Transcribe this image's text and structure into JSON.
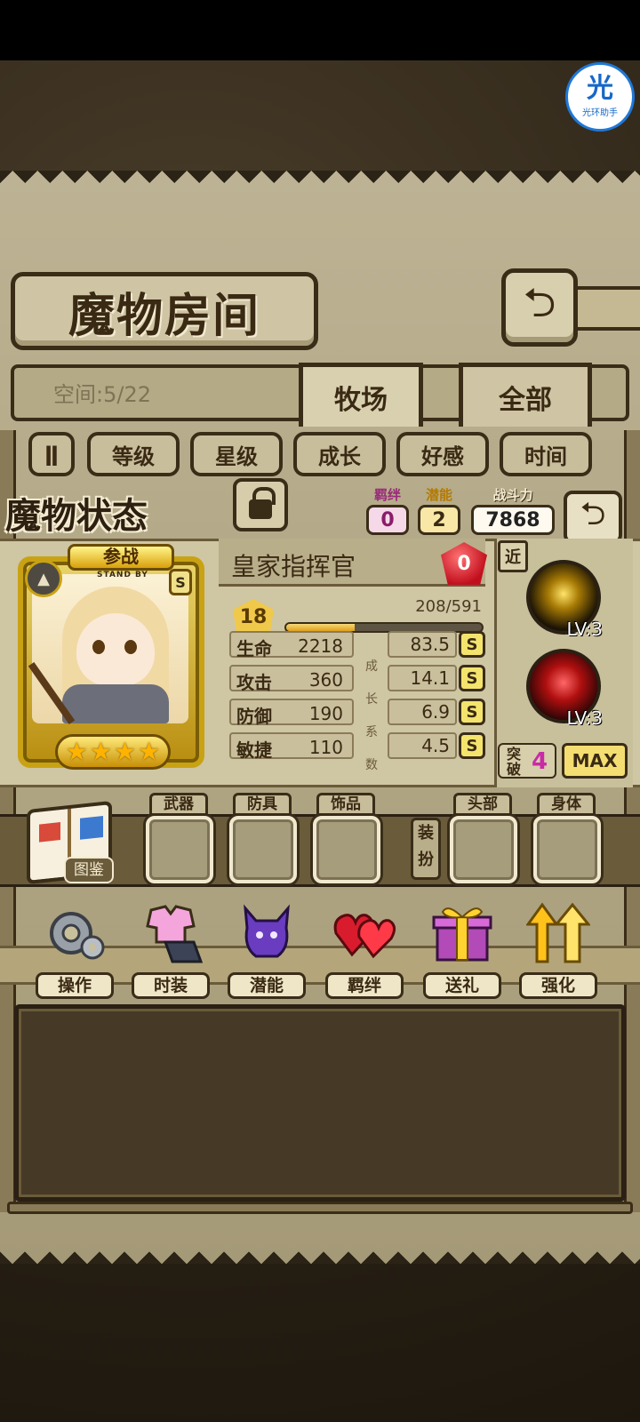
{
  "assistant_badge": {
    "glyph": "光",
    "label": "光环助手"
  },
  "page_title": "魔物房间",
  "space": "空间:5/22",
  "tabs": [
    {
      "label": "牧场",
      "active": true
    },
    {
      "label": "全部",
      "active": false
    }
  ],
  "filters": {
    "pause_icon": "pause-icon",
    "items": [
      "等级",
      "星级",
      "成长",
      "好感",
      "时间"
    ]
  },
  "status": {
    "title": "魔物状态",
    "bond": {
      "label": "羁绊",
      "value": "0"
    },
    "potential": {
      "label": "潜能",
      "value": "2"
    },
    "power": {
      "label": "战斗力",
      "value": "7868"
    }
  },
  "monster": {
    "deploy_label": "参战",
    "standby": "STAND BY",
    "rank": "S",
    "stars": 4,
    "name": "皇家指挥官",
    "affinity": "0",
    "level": "18",
    "exp_text": "208/591",
    "exp_fraction": 0.352,
    "growth_label": [
      "成",
      "长",
      "系",
      "数"
    ],
    "attributes": [
      {
        "key": "生命",
        "value": "2218",
        "growth": "83.5",
        "grade": "S"
      },
      {
        "key": "攻击",
        "value": "360",
        "growth": "14.1",
        "grade": "S"
      },
      {
        "key": "防御",
        "value": "190",
        "growth": "6.9",
        "grade": "S"
      },
      {
        "key": "敏捷",
        "value": "110",
        "growth": "4.5",
        "grade": "S"
      }
    ]
  },
  "skills": {
    "range": "近",
    "items": [
      {
        "name": "golden-shield-skill-icon",
        "level": "LV:3"
      },
      {
        "name": "red-vortex-skill-icon",
        "level": "LV:3"
      }
    ],
    "breakthrough": {
      "label": "突破",
      "value": "4"
    },
    "max_label": "MAX"
  },
  "equipment": {
    "codex_label": "图鉴",
    "slots_left": [
      "武器",
      "防具",
      "饰品"
    ],
    "dress_label": "装扮",
    "slots_right": [
      "头部",
      "身体"
    ]
  },
  "functions": [
    {
      "label": "操作",
      "icon": "gear-icon"
    },
    {
      "label": "时装",
      "icon": "costume-icon"
    },
    {
      "label": "潜能",
      "icon": "demon-icon"
    },
    {
      "label": "羁绊",
      "icon": "hearts-icon"
    },
    {
      "label": "送礼",
      "icon": "gift-icon"
    },
    {
      "label": "强化",
      "icon": "upgrade-arrows-icon"
    }
  ],
  "colors": {
    "parchment": "#b0a684",
    "frame_dark": "#3a2d18",
    "gold": "#c9a214",
    "badge_pink": "#8a1c6a",
    "break_pink": "#c82aa8"
  }
}
